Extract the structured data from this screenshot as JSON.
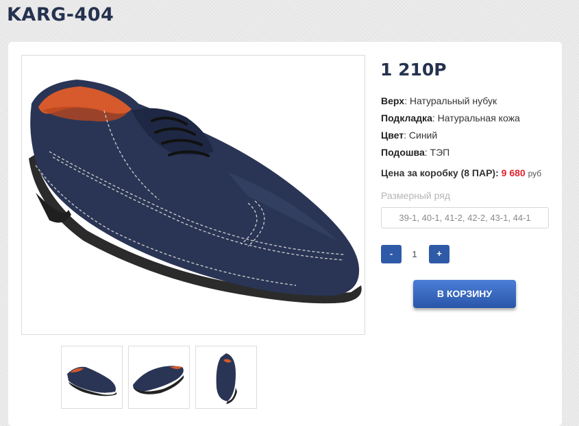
{
  "product": {
    "title": "KARG-404",
    "price": "1 210Р",
    "specs": [
      {
        "label": "Верх",
        "value": ": Натуральный нубук"
      },
      {
        "label": "Подкладка",
        "value": ": Натуральная кожа"
      },
      {
        "label": "Цвет",
        "value": ": Синий"
      },
      {
        "label": "Подошва",
        "value": ": ТЭП"
      }
    ],
    "box_price": {
      "label": "Цена за коробку (8 ПАР):",
      "amount": "9 680",
      "currency": "руб"
    },
    "size_range": {
      "label": "Размерный ряд",
      "value": "39-1, 40-1, 41-2, 42-2, 43-1, 44-1"
    },
    "quantity": {
      "minus": "-",
      "value": "1",
      "plus": "+"
    },
    "cart_button": "В КОРЗИНУ"
  },
  "colors": {
    "accent": "#2f5aa8",
    "price_red": "#e0232e",
    "shoe": "#2a3555"
  }
}
